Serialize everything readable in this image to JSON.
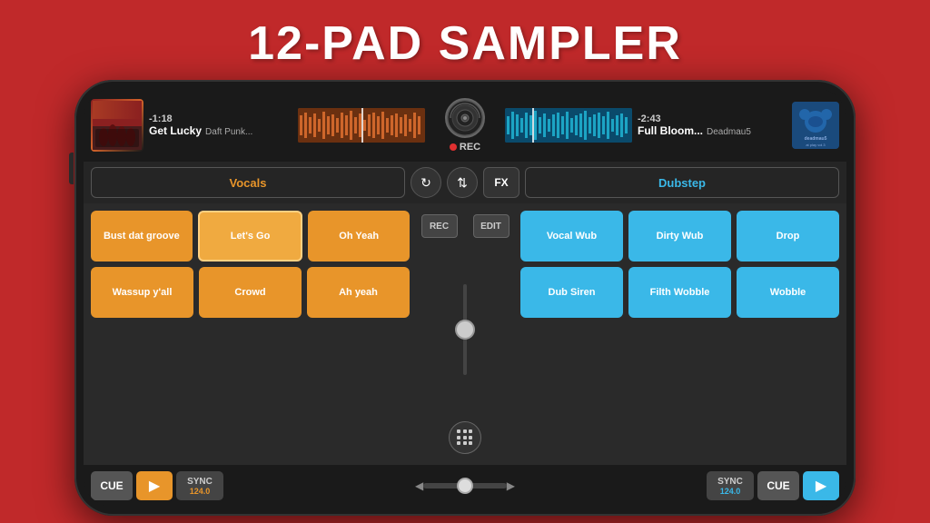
{
  "title": "12-PAD SAMPLER",
  "decks": {
    "left": {
      "time": "-1:18",
      "track": "Get Lucky",
      "artist": "Daft Punk...",
      "category": "Vocals"
    },
    "right": {
      "time": "-2:43",
      "track": "Full Bloom...",
      "artist": "Deadmau5",
      "category": "Dubstep"
    }
  },
  "controls": {
    "rec_label": "REC",
    "fx_label": "FX",
    "rec_btn": "REC",
    "edit_btn": "EDIT"
  },
  "pads_left": [
    {
      "label": "Bust dat groove",
      "type": "orange"
    },
    {
      "label": "Let's Go",
      "type": "orange-selected"
    },
    {
      "label": "Oh Yeah",
      "type": "orange"
    },
    {
      "label": "Wassup y'all",
      "type": "orange"
    },
    {
      "label": "Crowd",
      "type": "orange"
    },
    {
      "label": "Ah yeah",
      "type": "orange"
    }
  ],
  "pads_right": [
    {
      "label": "Vocal Wub",
      "type": "blue"
    },
    {
      "label": "Dirty Wub",
      "type": "blue"
    },
    {
      "label": "Drop",
      "type": "blue"
    },
    {
      "label": "Dub Siren",
      "type": "blue"
    },
    {
      "label": "Filth Wobble",
      "type": "blue"
    },
    {
      "label": "Wobble",
      "type": "blue"
    }
  ],
  "transport": {
    "cue_left": "CUE",
    "sync_left": "SYNC",
    "bpm_left": "124.0",
    "cue_right": "CUE",
    "sync_right": "SYNC",
    "bpm_right": "124.0"
  }
}
